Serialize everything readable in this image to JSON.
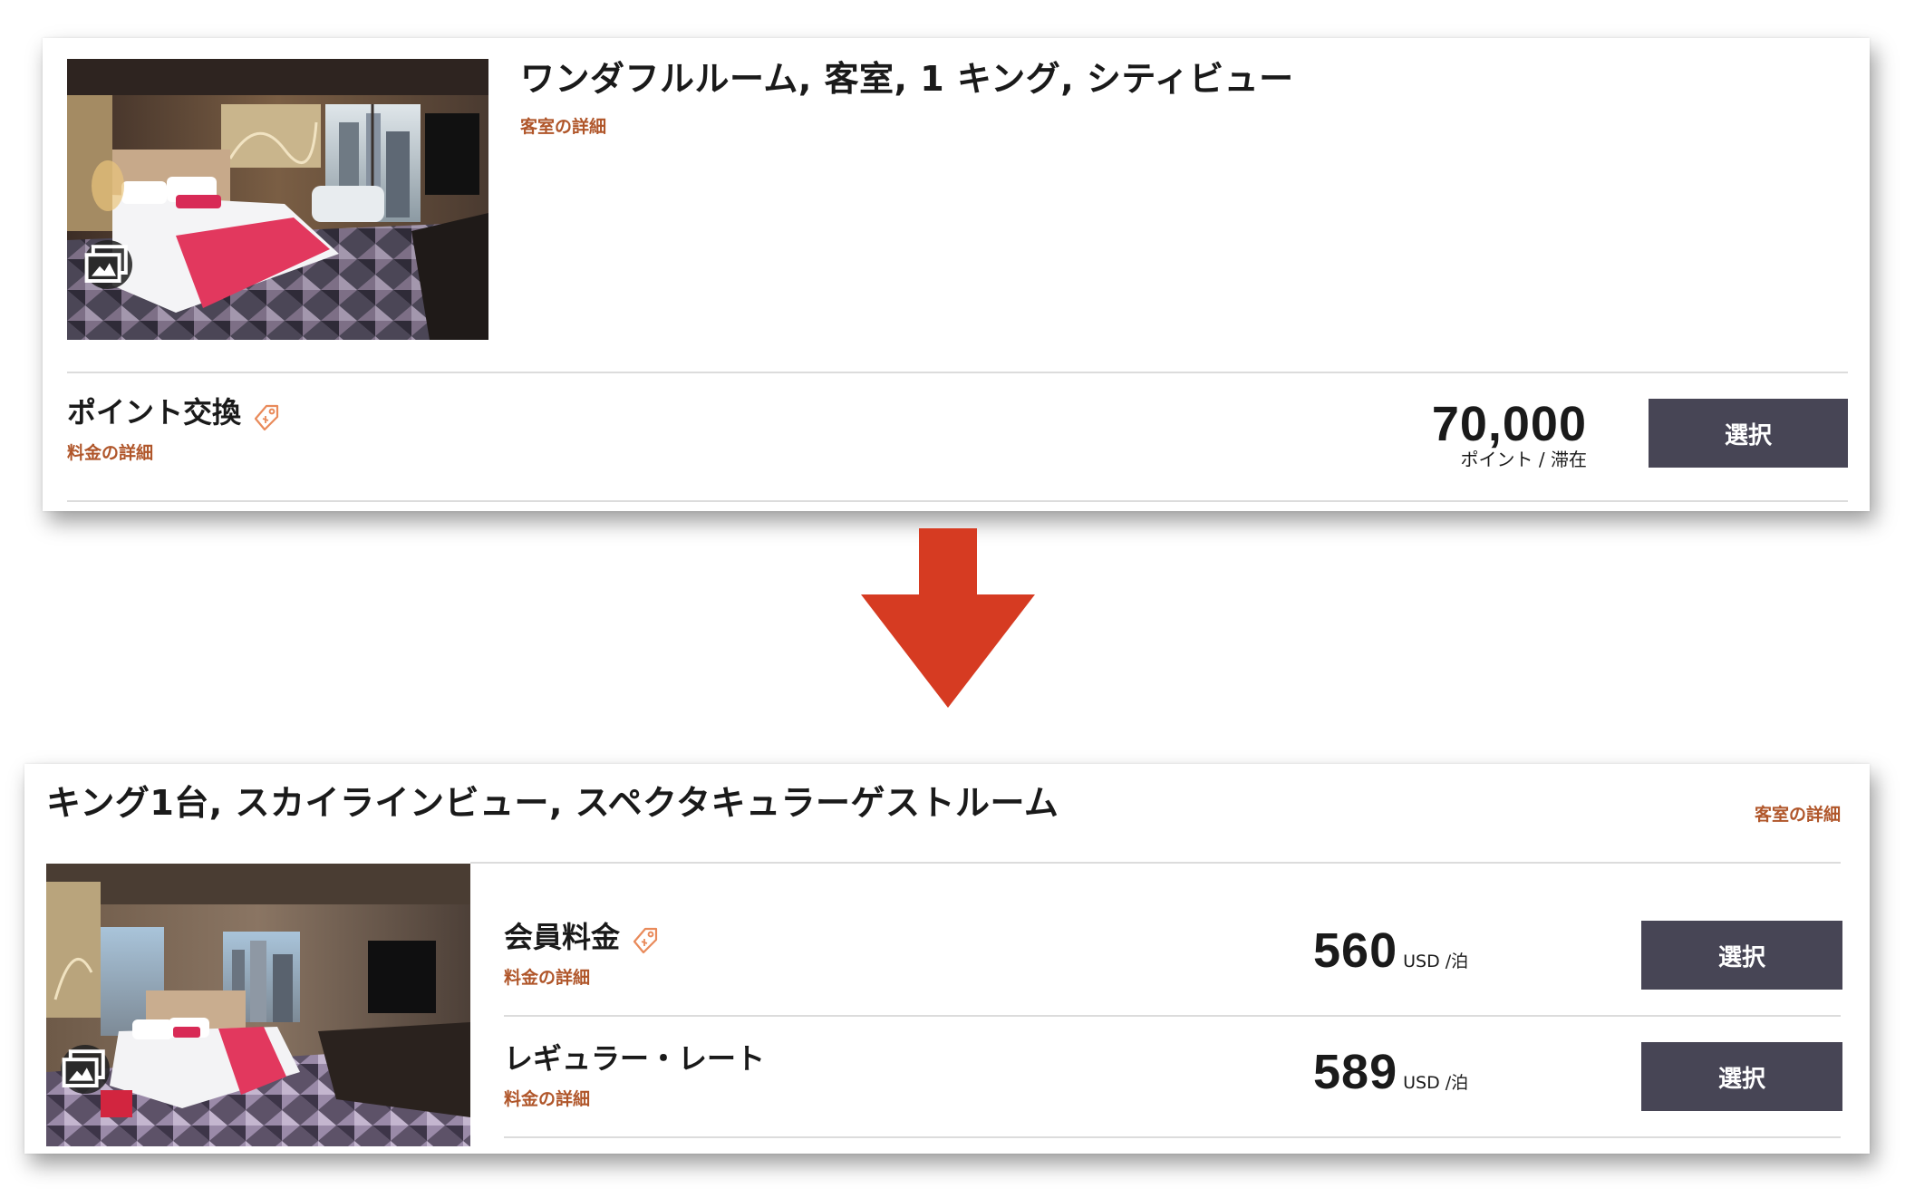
{
  "card_before": {
    "room_title": "ワンダフルルーム, 客室, 1 キング, シティビュー",
    "room_detail_link": "客室の詳細",
    "rate": {
      "name": "ポイント交換",
      "detail_link": "料金の詳細",
      "price": "70,000",
      "unit": "ポイント / 滞在",
      "select_label": "選択"
    }
  },
  "card_after": {
    "room_title": "キング1台, スカイラインビュー, スペクタキュラーゲストルーム",
    "room_detail_link": "客室の詳細",
    "rates": [
      {
        "name": "会員料金",
        "detail_link": "料金の詳細",
        "price": "560",
        "unit": "USD /泊",
        "select_label": "選択"
      },
      {
        "name": "レギュラー・レート",
        "detail_link": "料金の詳細",
        "price": "589",
        "unit": "USD /泊",
        "select_label": "選択"
      }
    ]
  },
  "colors": {
    "accent_link": "#b0562a",
    "button_bg": "#474555",
    "arrow": "#d63b22"
  },
  "icons": {
    "gallery": "gallery-icon",
    "tag": "tag-icon",
    "arrow": "down-arrow-icon"
  }
}
